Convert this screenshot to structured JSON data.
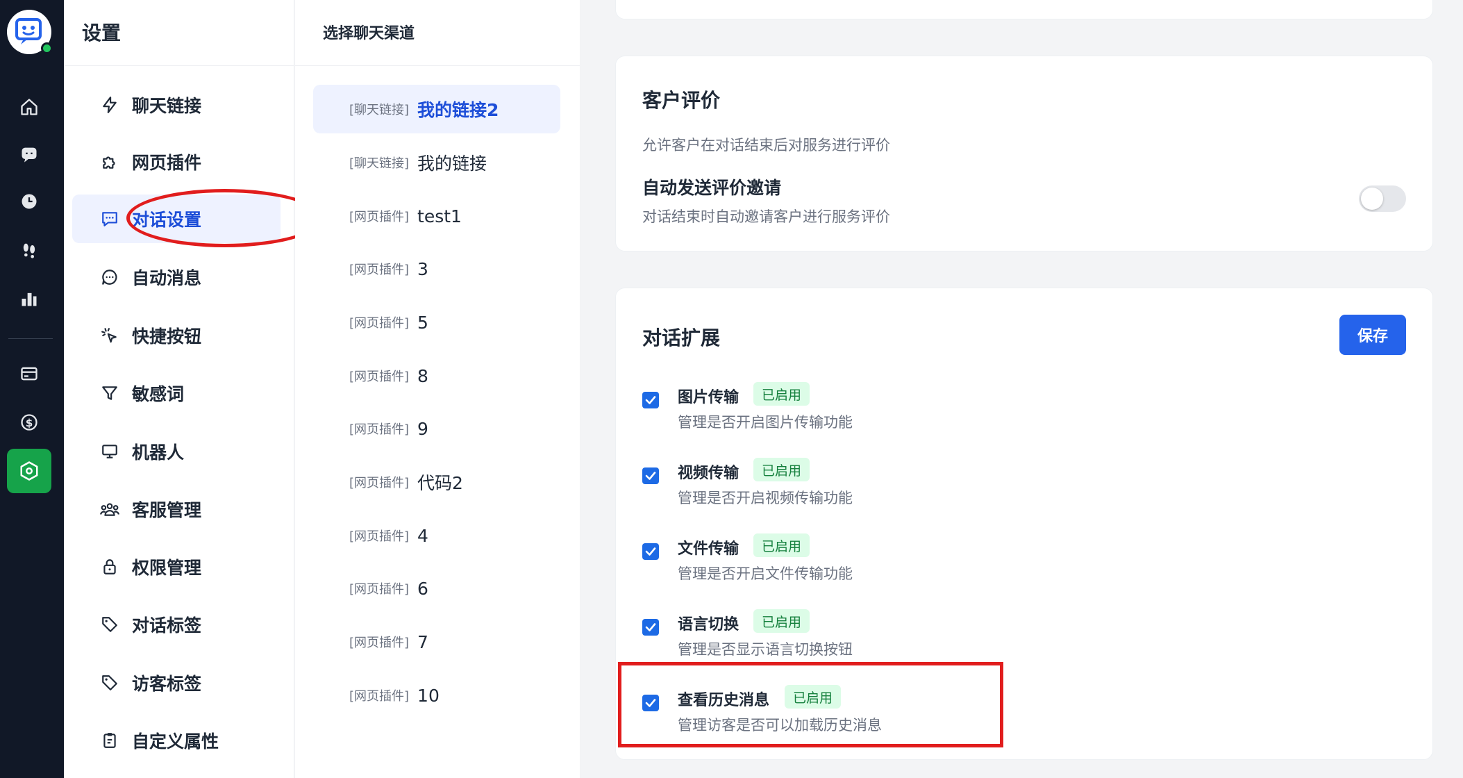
{
  "colors": {
    "rail_bg": "#111827",
    "accent": "#1d4ed8",
    "active_green": "#16a34a",
    "save_blue": "#2563eb",
    "badge_bg": "#dcfce7",
    "badge_text": "#15803d",
    "highlight_red": "#e11d1d"
  },
  "rail": {
    "icons": [
      "home-icon",
      "chat-bubble-icon",
      "clock-icon",
      "footprints-icon",
      "bar-chart-icon",
      "credit-card-icon",
      "dollar-icon",
      "settings-hexagon-icon"
    ],
    "active": "settings-hexagon-icon"
  },
  "nav": {
    "title": "设置",
    "items": [
      {
        "label": "聊天链接",
        "icon": "lightning-icon"
      },
      {
        "label": "网页插件",
        "icon": "puzzle-icon"
      },
      {
        "label": "对话设置",
        "icon": "message-square-icon",
        "active": true
      },
      {
        "label": "自动消息",
        "icon": "message-circle-icon"
      },
      {
        "label": "快捷按钮",
        "icon": "cursor-click-icon"
      },
      {
        "label": "敏感词",
        "icon": "filter-icon"
      },
      {
        "label": "机器人",
        "icon": "monitor-icon"
      },
      {
        "label": "客服管理",
        "icon": "users-icon"
      },
      {
        "label": "权限管理",
        "icon": "lock-icon"
      },
      {
        "label": "对话标签",
        "icon": "tag-icon"
      },
      {
        "label": "访客标签",
        "icon": "tag-icon"
      },
      {
        "label": "自定义属性",
        "icon": "clipboard-icon"
      }
    ]
  },
  "channels": {
    "title": "选择聊天渠道",
    "items": [
      {
        "tag": "[聊天链接]",
        "name": "我的链接2",
        "active": true
      },
      {
        "tag": "[聊天链接]",
        "name": "我的链接"
      },
      {
        "tag": "[网页插件]",
        "name": "test1"
      },
      {
        "tag": "[网页插件]",
        "name": "3"
      },
      {
        "tag": "[网页插件]",
        "name": "5"
      },
      {
        "tag": "[网页插件]",
        "name": "8"
      },
      {
        "tag": "[网页插件]",
        "name": "9"
      },
      {
        "tag": "[网页插件]",
        "name": "代码2"
      },
      {
        "tag": "[网页插件]",
        "name": "4"
      },
      {
        "tag": "[网页插件]",
        "name": "6"
      },
      {
        "tag": "[网页插件]",
        "name": "7"
      },
      {
        "tag": "[网页插件]",
        "name": "10"
      }
    ]
  },
  "rating": {
    "title": "客户评价",
    "desc": "允许客户在对话结束后对服务进行评价",
    "auto_invite_title": "自动发送评价邀请",
    "auto_invite_desc": "对话结束时自动邀请客户进行服务评价",
    "auto_invite_enabled": false
  },
  "extension": {
    "title": "对话扩展",
    "save_label": "保存",
    "features": [
      {
        "name": "图片传输",
        "badge": "已启用",
        "desc": "管理是否开启图片传输功能",
        "checked": true
      },
      {
        "name": "视频传输",
        "badge": "已启用",
        "desc": "管理是否开启视频传输功能",
        "checked": true
      },
      {
        "name": "文件传输",
        "badge": "已启用",
        "desc": "管理是否开启文件传输功能",
        "checked": true
      },
      {
        "name": "语言切换",
        "badge": "已启用",
        "desc": "管理是否显示语言切换按钮",
        "checked": true
      },
      {
        "name": "查看历史消息",
        "badge": "已启用",
        "desc": "管理访客是否可以加载历史消息",
        "checked": true
      }
    ]
  }
}
